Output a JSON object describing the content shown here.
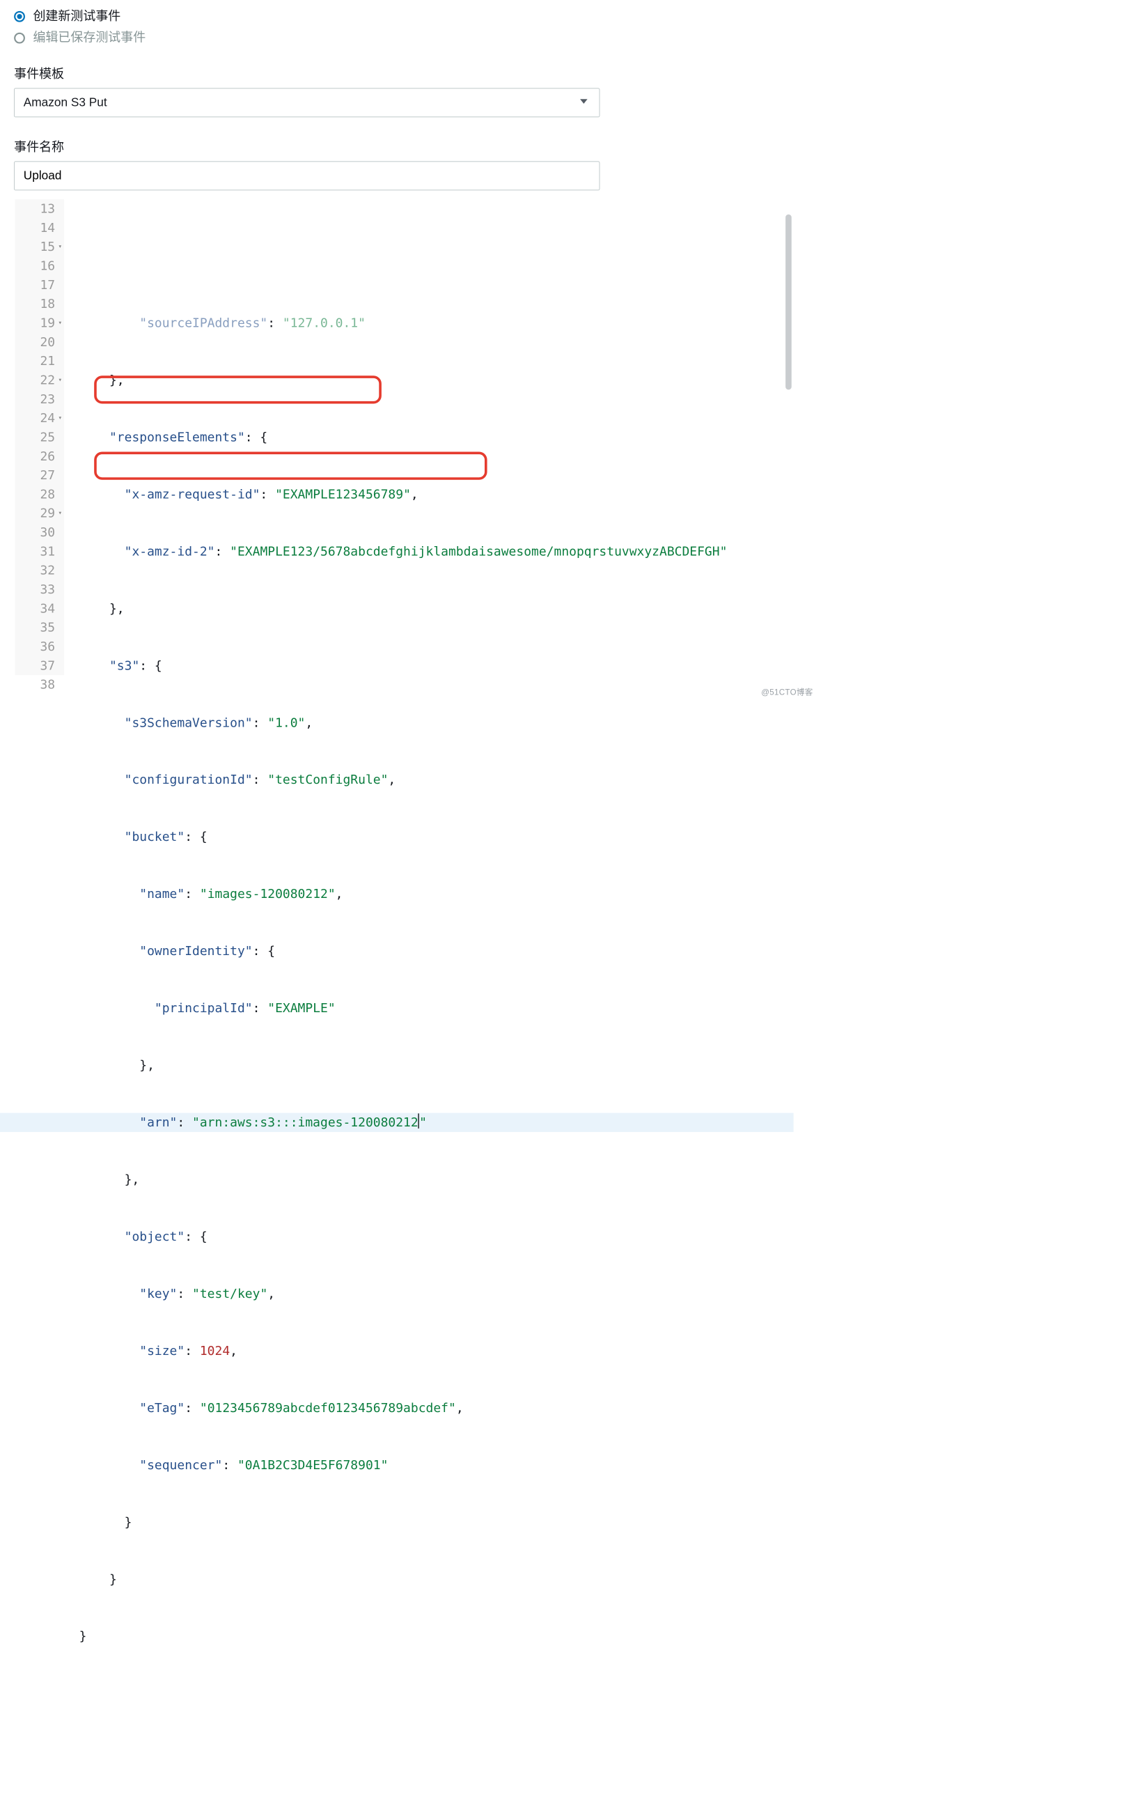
{
  "radio": {
    "create_label": "创建新测试事件",
    "edit_label": "编辑已保存测试事件"
  },
  "template": {
    "label": "事件模板",
    "selected": "Amazon S3 Put"
  },
  "event_name": {
    "label": "事件名称",
    "value": "Upload"
  },
  "watermark": "@51CTO博客",
  "gutter_lines": [
    "13",
    "14",
    "15",
    "16",
    "17",
    "18",
    "19",
    "20",
    "21",
    "22",
    "23",
    "24",
    "25",
    "26",
    "27",
    "28",
    "29",
    "30",
    "31",
    "32",
    "33",
    "34",
    "35",
    "36",
    "37",
    "38"
  ],
  "fold_lines": [
    "15",
    "19",
    "22",
    "24",
    "29"
  ],
  "code": {
    "l13": {
      "pre": "          ",
      "key": "sourceIPAddress",
      "sep": ": ",
      "val": "127.0.0.1"
    },
    "l14": {
      "pre": "      ",
      "brace": "},"
    },
    "l15": {
      "pre": "      ",
      "key": "responseElements",
      "sep": ": ",
      "brace": "{"
    },
    "l16": {
      "pre": "        ",
      "key": "x-amz-request-id",
      "sep": ": ",
      "val": "EXAMPLE123456789",
      "tail": ","
    },
    "l17": {
      "pre": "        ",
      "key": "x-amz-id-2",
      "sep": ": ",
      "val": "EXAMPLE123/5678abcdefghijklambdaisawesome/mnopqrstuvwxyzABCDEFGH"
    },
    "l18": {
      "pre": "      ",
      "brace": "},"
    },
    "l19": {
      "pre": "      ",
      "key": "s3",
      "sep": ": ",
      "brace": "{"
    },
    "l20": {
      "pre": "        ",
      "key": "s3SchemaVersion",
      "sep": ": ",
      "val": "1.0",
      "tail": ","
    },
    "l21": {
      "pre": "        ",
      "key": "configurationId",
      "sep": ": ",
      "val": "testConfigRule",
      "tail": ","
    },
    "l22": {
      "pre": "        ",
      "key": "bucket",
      "sep": ": ",
      "brace": "{"
    },
    "l23": {
      "pre": "          ",
      "key": "name",
      "sep": ": ",
      "val": "images-120080212",
      "tail": ","
    },
    "l24": {
      "pre": "          ",
      "key": "ownerIdentity",
      "sep": ": ",
      "brace": "{"
    },
    "l25": {
      "pre": "            ",
      "key": "principalId",
      "sep": ": ",
      "val": "EXAMPLE"
    },
    "l26": {
      "pre": "          ",
      "brace": "},"
    },
    "l27": {
      "pre": "          ",
      "key": "arn",
      "sep": ": ",
      "val": "arn:aws:s3:::images-120080212"
    },
    "l28": {
      "pre": "        ",
      "brace": "},"
    },
    "l29": {
      "pre": "        ",
      "key": "object",
      "sep": ": ",
      "brace": "{"
    },
    "l30": {
      "pre": "          ",
      "key": "key",
      "sep": ": ",
      "val": "test/key",
      "tail": ","
    },
    "l31": {
      "pre": "          ",
      "key": "size",
      "sep": ": ",
      "num": "1024",
      "tail": ","
    },
    "l32": {
      "pre": "          ",
      "key": "eTag",
      "sep": ": ",
      "val": "0123456789abcdef0123456789abcdef",
      "tail": ","
    },
    "l33": {
      "pre": "          ",
      "key": "sequencer",
      "sep": ": ",
      "val": "0A1B2C3D4E5F678901"
    },
    "l34": {
      "pre": "        ",
      "brace": "}"
    },
    "l35": {
      "pre": "      ",
      "brace": "}"
    },
    "l36": {
      "pre": "  ",
      "brace": "}"
    }
  }
}
